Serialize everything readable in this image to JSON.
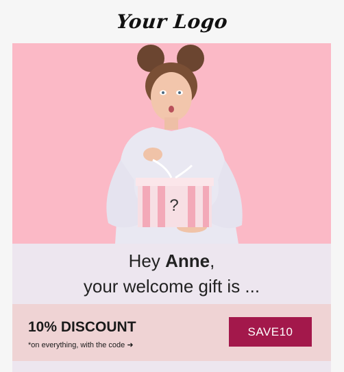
{
  "brand": {
    "logo_text": "Your Logo"
  },
  "hero": {
    "gift_mark": "?",
    "background_color": "#fbb9c6"
  },
  "greeting": {
    "salutation": "Hey",
    "name": "Anne",
    "punct": ",",
    "line2": "your welcome gift is ..."
  },
  "offer": {
    "title": "10% DISCOUNT",
    "note": "*on everything, with the code",
    "arrow": "➜",
    "code": "SAVE10",
    "button_color": "#a3184b"
  }
}
